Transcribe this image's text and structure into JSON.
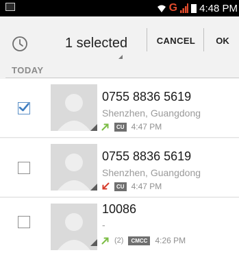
{
  "status_bar": {
    "network": "G",
    "time": "4:48 PM"
  },
  "action_bar": {
    "icon": "clock-icon",
    "selected_text": "1 selected",
    "cancel_label": "CANCEL",
    "ok_label": "OK"
  },
  "section": {
    "label": "TODAY"
  },
  "calls": [
    {
      "number": "0755 8836 5619",
      "location": "Shenzhen, Guangdong",
      "call_type": "outgoing",
      "count": "",
      "carrier": "CU",
      "time": "4:47 PM",
      "checked": true
    },
    {
      "number": "0755 8836 5619",
      "location": "Shenzhen, Guangdong",
      "call_type": "missed",
      "count": "",
      "carrier": "CU",
      "time": "4:47 PM",
      "checked": false
    },
    {
      "number": "10086",
      "location": "-",
      "call_type": "outgoing",
      "count": "(2)",
      "carrier": "CMCC",
      "time": "4:26 PM",
      "checked": false
    }
  ],
  "colors": {
    "outgoing_arrow": "#7cbd45",
    "missed_arrow": "#d73b2b",
    "network_accent": "#e14b2c",
    "checkbox_accent": "#3f7ec1"
  }
}
